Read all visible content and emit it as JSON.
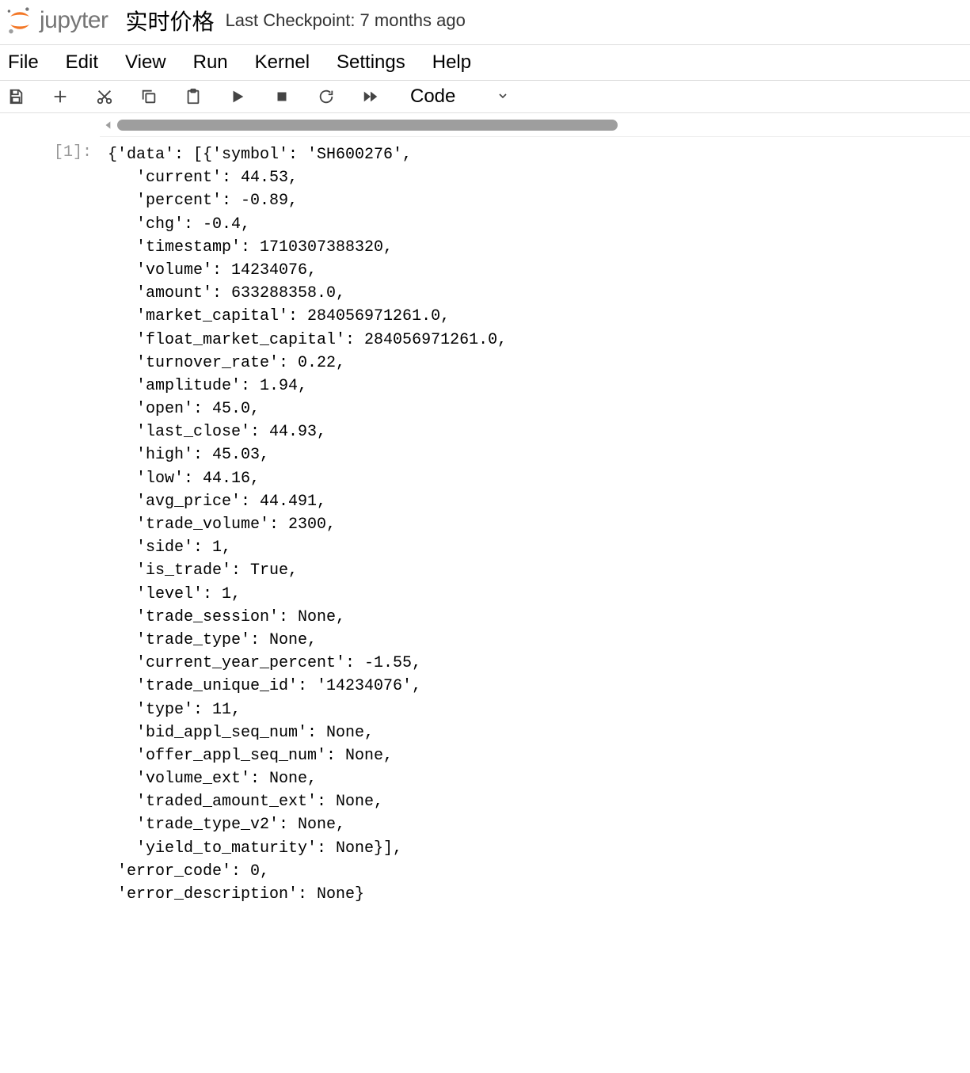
{
  "header": {
    "logo_text": "jupyter",
    "notebook_title": "实时价格",
    "checkpoint": "Last Checkpoint: 7 months ago"
  },
  "menubar": {
    "file": "File",
    "edit": "Edit",
    "view": "View",
    "run": "Run",
    "kernel": "Kernel",
    "settings": "Settings",
    "help": "Help"
  },
  "toolbar": {
    "celltype_selected": "Code"
  },
  "cell": {
    "prompt": "[1]:",
    "output": "{'data': [{'symbol': 'SH600276',\n   'current': 44.53,\n   'percent': -0.89,\n   'chg': -0.4,\n   'timestamp': 1710307388320,\n   'volume': 14234076,\n   'amount': 633288358.0,\n   'market_capital': 284056971261.0,\n   'float_market_capital': 284056971261.0,\n   'turnover_rate': 0.22,\n   'amplitude': 1.94,\n   'open': 45.0,\n   'last_close': 44.93,\n   'high': 45.03,\n   'low': 44.16,\n   'avg_price': 44.491,\n   'trade_volume': 2300,\n   'side': 1,\n   'is_trade': True,\n   'level': 1,\n   'trade_session': None,\n   'trade_type': None,\n   'current_year_percent': -1.55,\n   'trade_unique_id': '14234076',\n   'type': 11,\n   'bid_appl_seq_num': None,\n   'offer_appl_seq_num': None,\n   'volume_ext': None,\n   'traded_amount_ext': None,\n   'trade_type_v2': None,\n   'yield_to_maturity': None}],\n 'error_code': 0,\n 'error_description': None}"
  }
}
